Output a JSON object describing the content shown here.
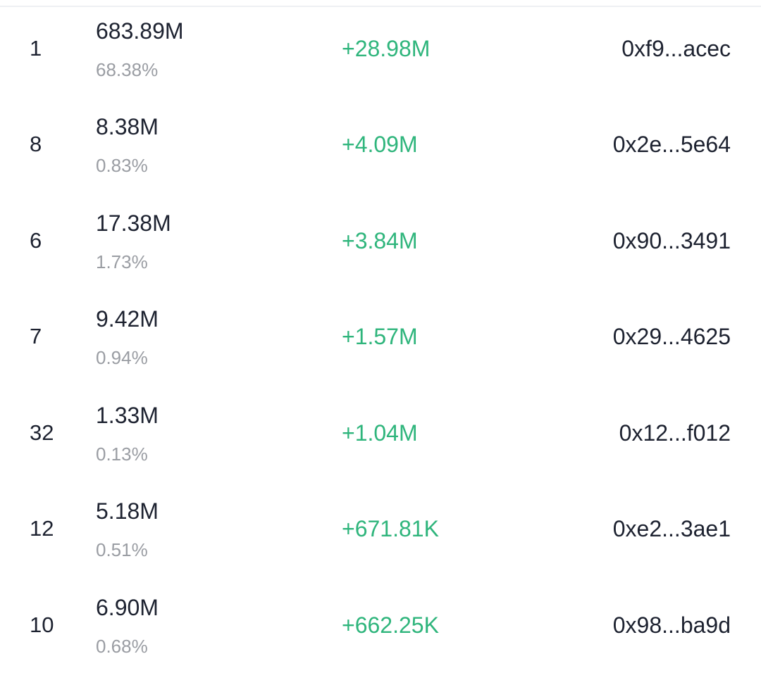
{
  "colors": {
    "primary_text": "#1d2230",
    "secondary_text": "#9a9da3",
    "positive_change": "#2fb57c",
    "divider": "#eef0f3"
  },
  "holders": [
    {
      "rank": "1",
      "balance": "683.89M",
      "share": "68.38%",
      "change": "+28.98M",
      "address": "0xf9...acec"
    },
    {
      "rank": "8",
      "balance": "8.38M",
      "share": "0.83%",
      "change": "+4.09M",
      "address": "0x2e...5e64"
    },
    {
      "rank": "6",
      "balance": "17.38M",
      "share": "1.73%",
      "change": "+3.84M",
      "address": "0x90...3491"
    },
    {
      "rank": "7",
      "balance": "9.42M",
      "share": "0.94%",
      "change": "+1.57M",
      "address": "0x29...4625"
    },
    {
      "rank": "32",
      "balance": "1.33M",
      "share": "0.13%",
      "change": "+1.04M",
      "address": "0x12...f012"
    },
    {
      "rank": "12",
      "balance": "5.18M",
      "share": "0.51%",
      "change": "+671.81K",
      "address": "0xe2...3ae1"
    },
    {
      "rank": "10",
      "balance": "6.90M",
      "share": "0.68%",
      "change": "+662.25K",
      "address": "0x98...ba9d"
    }
  ]
}
